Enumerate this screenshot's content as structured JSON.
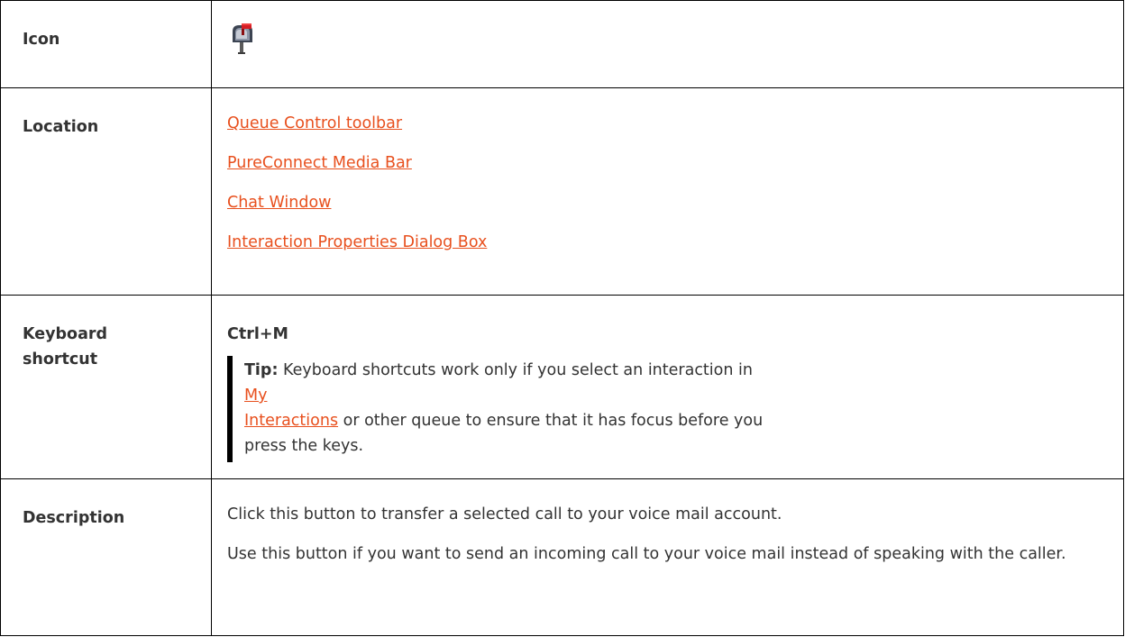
{
  "rows": {
    "icon": {
      "label": "Icon",
      "icon_name": "voicemail-mailbox-icon"
    },
    "location": {
      "label": "Location",
      "links": [
        "Queue Control toolbar",
        "PureConnect Media Bar",
        "Chat Window",
        "Interaction Properties Dialog Box"
      ]
    },
    "keyboard": {
      "label_line1": "Keyboard",
      "label_line2": "shortcut",
      "shortcut": "Ctrl+M",
      "tip_label": "Tip:",
      "tip_text_before": " Keyboard shortcuts work only if you select an interaction in ",
      "tip_link_line1": "My",
      "tip_link_line2": "Interactions",
      "tip_text_after": " or other queue to ensure that it has focus before you press the keys."
    },
    "description": {
      "label": "Description",
      "paragraph1": "Click this button to transfer a selected call to your voice mail account.",
      "paragraph2": "Use this button if you want to send an incoming call to your voice mail instead of speaking with the caller."
    }
  },
  "colors": {
    "link": "#e8501e",
    "text": "#333333",
    "border": "#000000"
  }
}
